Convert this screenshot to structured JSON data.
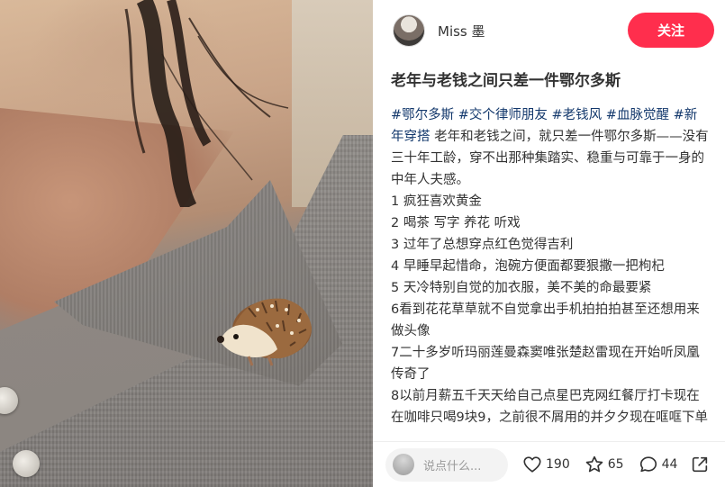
{
  "author": {
    "name": "Miss 墨",
    "follow_label": "关注"
  },
  "post": {
    "title": "老年与老钱之间只差一件鄂尔多斯",
    "tags": [
      "#鄂尔多斯",
      "#交个律师朋友",
      "#老钱风",
      "#血脉觉醒",
      "#新年穿搭"
    ],
    "intro": "老年和老钱之间，就只差一件鄂尔多斯——没有三十年工龄，穿不出那种集踏实、稳重与可靠于一身的中年人夫感。",
    "lines": [
      "1 疯狂喜欢黄金",
      "2 喝茶 写字 养花 听戏",
      "3 过年了总想穿点红色觉得吉利",
      "4 早睡早起惜命，泡碗方便面都要狠撒一把枸杞",
      "5 天冷特别自觉的加衣服，美不美的命最要紧",
      "6看到花花草草就不自觉拿出手机拍拍拍甚至还想用来做头像",
      "7二十多岁听玛丽莲曼森窦唯张楚赵雷现在开始听凤凰传奇了",
      "8以前月薪五千天天给自己点星巴克网红餐厅打卡现在在咖啡只喝9块9，之前很不屑用的并夕夕现在哐哐下单"
    ]
  },
  "bottom_bar": {
    "comment_placeholder": "说点什么...",
    "likes": "190",
    "stars": "65",
    "comments": "44"
  },
  "colors": {
    "accent": "#ff2e4d",
    "tag": "#13386c"
  }
}
